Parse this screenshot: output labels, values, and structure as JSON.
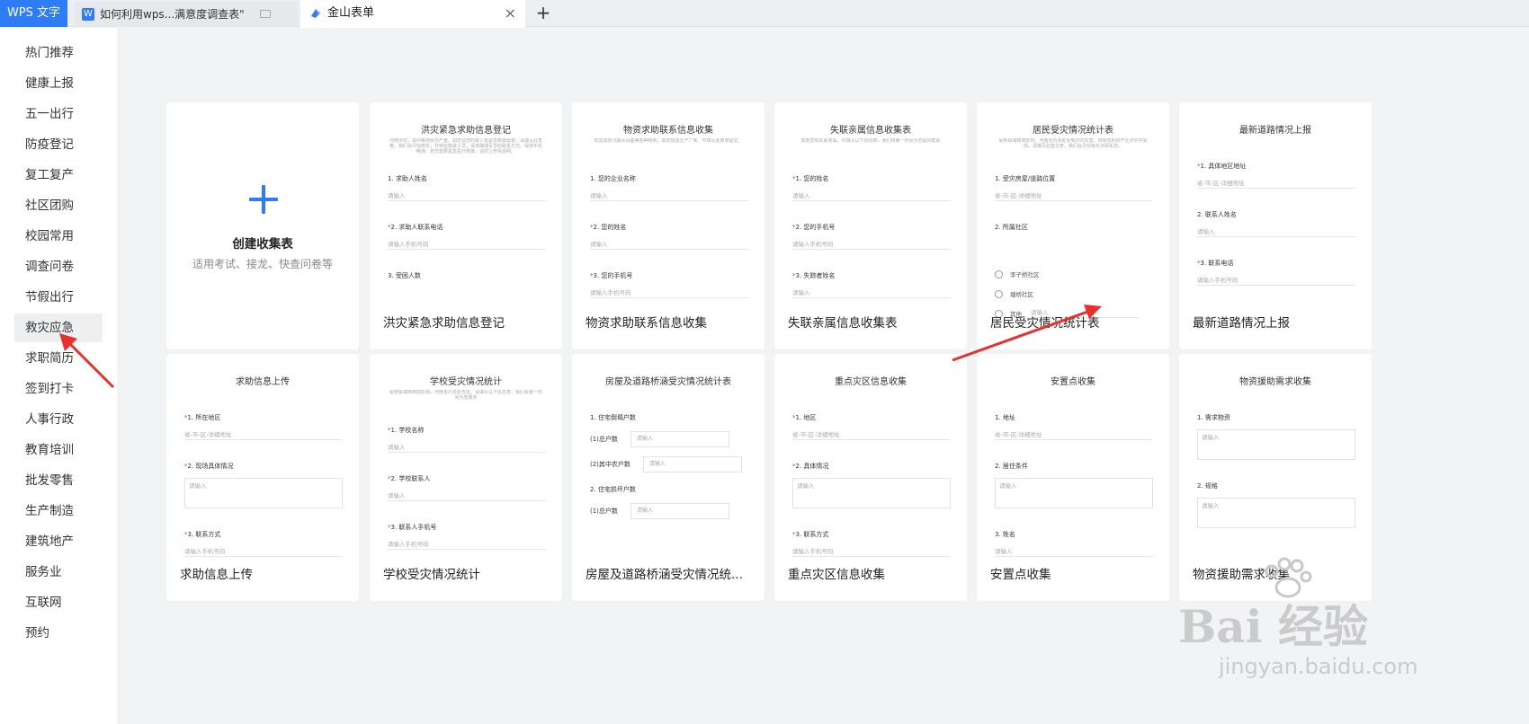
{
  "tabs": {
    "app": "WPS 文字",
    "doc": "如何利用wps...满意度调查表\"",
    "form": "金山表单",
    "add": "+",
    "close": "×"
  },
  "sidebar": {
    "items": [
      "热门推荐",
      "健康上报",
      "五一出行",
      "防疫登记",
      "复工复产",
      "社区团购",
      "校园常用",
      "调查问卷",
      "节假出行",
      "救灾应急",
      "求职简历",
      "签到打卡",
      "人事行政",
      "教育培训",
      "批发零售",
      "生产制造",
      "建筑地产",
      "服务业",
      "互联网",
      "预约"
    ],
    "active": "救灾应急"
  },
  "create": {
    "title": "创建收集表",
    "subtitle": "适用考试、接龙、快查问卷等"
  },
  "templates": [
    {
      "name": "洪灾紧急求助信息登记",
      "title": "洪灾紧急求助信息登记",
      "desc": "河南洪灾，郑州等地受灾严重。如您及您的家人有紧急救援需要，请填写此表格。我们会尽快核实，并转给救援人员。请准确填写您的联系方式，保持手机畅通。若您需要紧急医疗救援，请附上伤情说明。",
      "fields": [
        {
          "label": "1. 求助人姓名",
          "req": false,
          "ph": "请输入"
        },
        {
          "label": "2. 求助人联系电话",
          "req": true,
          "ph": "请输入手机号码"
        },
        {
          "label": "3. 受困人数",
          "req": false,
          "ph": ""
        }
      ]
    },
    {
      "name": "物资求助联系信息收集",
      "title": "物资求助联系信息收集",
      "desc": "现急需防汛抽水设备等各种物资，如您知道生产厂家，可填写此表单提交。",
      "fields": [
        {
          "label": "1. 您的企业名称",
          "req": false,
          "ph": "请输入"
        },
        {
          "label": "2. 您的姓名",
          "req": true,
          "ph": "请输入"
        },
        {
          "label": "3. 您的手机号",
          "req": true,
          "ph": "请输入手机号码"
        }
      ]
    },
    {
      "name": "失联亲属信息收集表",
      "title": "失联亲属信息收集表",
      "desc": "如若您有失联亲属，可填写以下信息表，我们将第一时间为您提供帮助",
      "fields": [
        {
          "label": "1. 您的姓名",
          "req": true,
          "ph": "请输入"
        },
        {
          "label": "2. 您的手机号",
          "req": true,
          "ph": "请输入手机号码"
        },
        {
          "label": "3. 失踪者姓名",
          "req": true,
          "ph": "请输入"
        }
      ]
    },
    {
      "name": "居民受灾情况统计表",
      "title": "居民受灾情况统计表",
      "desc": "受到极端降雨影响，河南省内多处受到洪灾灾害。如果您的财产在洪灾中受损，请填写此登记表，我们会尽快核实并联系您。",
      "fields": [
        {
          "label": "1. 受灾房屋/道路位置",
          "req": false,
          "ph": "省-市-区-详细地址"
        },
        {
          "label": "2. 所属社区",
          "req": false,
          "ph": ""
        }
      ],
      "radios": [
        "李子桥社区",
        "塘桥社区",
        "其他"
      ],
      "radio_ph": "请输入"
    },
    {
      "name": "最新道路情况上报",
      "title": "最新道路情况上报",
      "desc": "",
      "fields": [
        {
          "label": "1. 具体地区地址",
          "req": true,
          "ph": "省-市-区-详细地址"
        },
        {
          "label": "2. 联系人姓名",
          "req": false,
          "ph": "请输入"
        },
        {
          "label": "3. 联系电话",
          "req": true,
          "ph": "请输入手机号码"
        }
      ]
    },
    {
      "name": "求助信息上传",
      "title": "求助信息上传",
      "desc": "",
      "fields": [
        {
          "label": "1. 所在地区",
          "req": true,
          "ph": "省-市-区-详细地址"
        },
        {
          "label": "2. 现场具体情况",
          "req": true,
          "ph": "请输入",
          "box": true
        },
        {
          "label": "3. 联系方式",
          "req": true,
          "ph": "请输入手机号码"
        }
      ]
    },
    {
      "name": "学校受灾情况统计",
      "title": "学校受灾情况统计",
      "desc": "受到极端降雨的影响，河南省内多处告急。请填写以下信息表，我们会第一时间为您服务",
      "fields": [
        {
          "label": "1. 学校名称",
          "req": true,
          "ph": "请输入"
        },
        {
          "label": "2. 学校联系人",
          "req": true,
          "ph": "请输入"
        },
        {
          "label": "3. 联系人手机号",
          "req": true,
          "ph": "请输入手机号码"
        }
      ]
    },
    {
      "name": "房屋及道路桥涵受灾情况统...",
      "title": "房屋及道路桥涵受灾情况统计表",
      "desc": "",
      "sections": [
        {
          "label": "1. 住宅倒塌户数",
          "rows": [
            "(1)总户数",
            "(2)其中农户数"
          ]
        },
        {
          "label": "2. 住宅损坏户数",
          "rows": [
            "(1)总户数"
          ]
        }
      ],
      "row_ph": "请输入"
    },
    {
      "name": "重点灾区信息收集",
      "title": "重点灾区信息收集",
      "desc": "",
      "fields": [
        {
          "label": "1. 地区",
          "req": true,
          "ph": "省-市-区-详细地址"
        },
        {
          "label": "2. 具体情况",
          "req": true,
          "ph": "请输入",
          "box": true
        },
        {
          "label": "3. 联系方式",
          "req": true,
          "ph": "请输入手机号码"
        }
      ]
    },
    {
      "name": "安置点收集",
      "title": "安置点收集",
      "desc": "",
      "fields": [
        {
          "label": "1. 地址",
          "req": false,
          "ph": "省-市-区-详细地址"
        },
        {
          "label": "2. 居住条件",
          "req": false,
          "ph": "请输入",
          "box": true
        },
        {
          "label": "3. 姓名",
          "req": false,
          "ph": "请输入"
        }
      ]
    },
    {
      "name": "物资援助需求收集",
      "title": "物资援助需求收集",
      "desc": "",
      "fields": [
        {
          "label": "1. 需求物资",
          "req": false,
          "ph": "请输入",
          "box": true
        },
        {
          "label": "2. 规格",
          "req": false,
          "ph": "请输入",
          "box": true
        }
      ]
    }
  ],
  "watermark": {
    "logo": "Bai 经验",
    "url": "jingyan.baidu.com"
  },
  "colors": {
    "accent": "#2f7df6",
    "arrow": "#e8302c",
    "required": "#e33"
  }
}
